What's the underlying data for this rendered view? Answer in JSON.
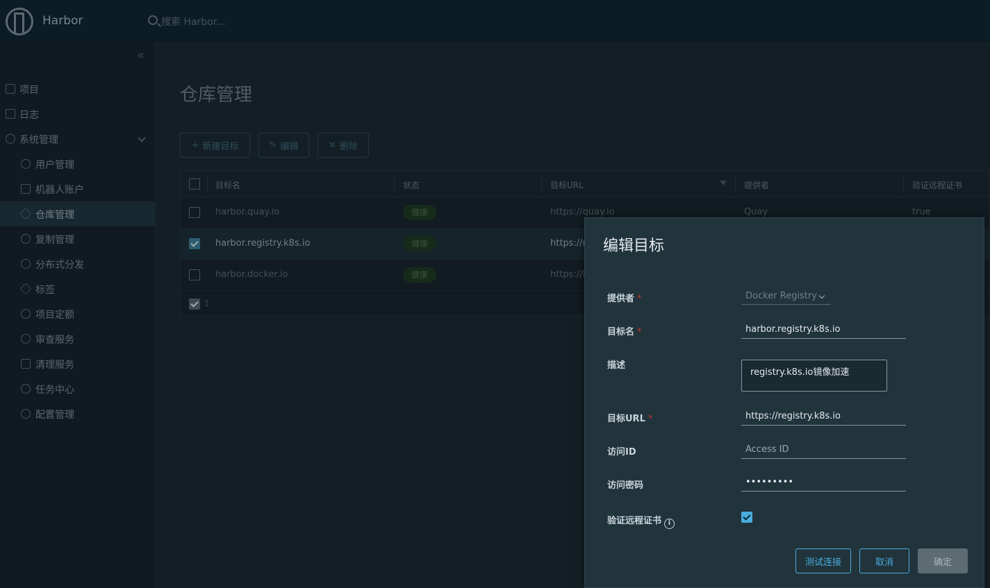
{
  "header": {
    "app_title": "Harbor",
    "search_placeholder": "搜索 Harbor..."
  },
  "sidebar": {
    "items": [
      {
        "label": "项目",
        "icon": "projects-icon"
      },
      {
        "label": "日志",
        "icon": "logs-icon"
      },
      {
        "label": "系统管理",
        "icon": "admin-icon",
        "expanded": true
      },
      {
        "label": "用户管理",
        "icon": "users-icon"
      },
      {
        "label": "机器人账户",
        "icon": "robot-icon"
      },
      {
        "label": "仓库管理",
        "icon": "registry-icon",
        "active": true
      },
      {
        "label": "复制管理",
        "icon": "replication-icon"
      },
      {
        "label": "分布式分发",
        "icon": "distribution-icon"
      },
      {
        "label": "标签",
        "icon": "tag-icon"
      },
      {
        "label": "项目定额",
        "icon": "quota-icon"
      },
      {
        "label": "审查服务",
        "icon": "scanner-icon"
      },
      {
        "label": "清理服务",
        "icon": "trash-icon"
      },
      {
        "label": "任务中心",
        "icon": "job-icon"
      },
      {
        "label": "配置管理",
        "icon": "config-icon"
      }
    ]
  },
  "main": {
    "title": "仓库管理",
    "toolbar": {
      "new_label": "新建目标",
      "edit_label": "编辑",
      "delete_label": "删除"
    },
    "table": {
      "headers": [
        "目标名",
        "状态",
        "目标URL",
        "提供者",
        "验证远程证书"
      ],
      "rows": [
        {
          "name": "harbor.quay.io",
          "status": "健康",
          "url": "https://quay.io",
          "provider": "Quay",
          "verify": "true",
          "selected": false
        },
        {
          "name": "harbor.registry.k8s.io",
          "status": "健康",
          "url": "https://r",
          "provider": "",
          "verify": "",
          "selected": true
        },
        {
          "name": "harbor.docker.io",
          "status": "健康",
          "url": "https://h",
          "provider": "",
          "verify": "",
          "selected": false
        }
      ],
      "footer_count": "1"
    }
  },
  "modal": {
    "title": "编辑目标",
    "fields": {
      "provider_label": "提供者",
      "provider_value": "Docker Registry",
      "name_label": "目标名",
      "name_value": "harbor.registry.k8s.io",
      "desc_label": "描述",
      "desc_value": "registry.k8s.io镜像加速",
      "url_label": "目标URL",
      "url_value": "https://registry.k8s.io",
      "access_id_label": "访问ID",
      "access_id_placeholder": "Access ID",
      "secret_label": "访问密码",
      "secret_value": "•••••••••",
      "verify_label": "验证远程证书",
      "verify_checked": true
    },
    "required_mark": "*",
    "buttons": {
      "test_label": "测试连接",
      "cancel_label": "取消",
      "ok_label": "确定"
    }
  }
}
